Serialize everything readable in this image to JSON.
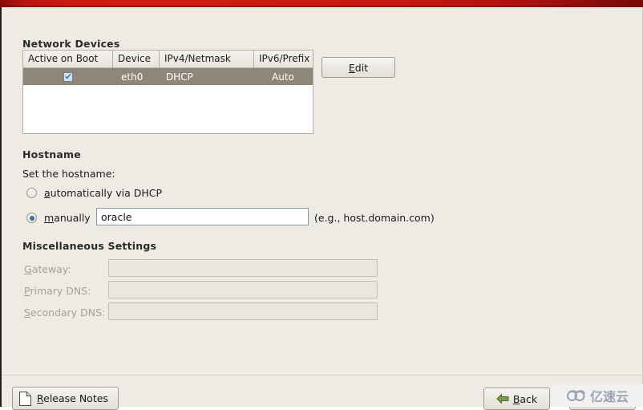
{
  "window": {
    "accent_band_color": "#cc1a12",
    "background_color": "#eeebe5"
  },
  "network_devices": {
    "heading": "Network Devices",
    "columns": [
      "Active on Boot",
      "Device",
      "IPv4/Netmask",
      "IPv6/Prefix"
    ],
    "rows": [
      {
        "active_on_boot": true,
        "device": "eth0",
        "ipv4_netmask": "DHCP",
        "ipv6_prefix": "Auto",
        "selected": true
      }
    ],
    "edit_button": {
      "label": "Edit",
      "mnemonic_prefix": "E",
      "mnemonic_rest": "dit"
    }
  },
  "hostname": {
    "heading": "Hostname",
    "prompt": "Set the hostname:",
    "options": [
      {
        "id": "automatic",
        "mnemonic_prefix": "a",
        "mnemonic_rest": "utomatically via DHCP",
        "selected": false
      },
      {
        "id": "manual",
        "mnemonic_prefix": "m",
        "mnemonic_rest": "anually",
        "selected": true
      }
    ],
    "input_value": "oracle",
    "input_placeholder": "",
    "example_hint": "(e.g., host.domain.com)"
  },
  "miscellaneous": {
    "heading": "Miscellaneous Settings",
    "fields": [
      {
        "mnemonic_prefix": "G",
        "mnemonic_rest": "ateway:",
        "value": "",
        "enabled": false
      },
      {
        "mnemonic_prefix": "P",
        "mnemonic_rest": "rimary DNS:",
        "value": "",
        "enabled": false
      },
      {
        "mnemonic_prefix": "S",
        "mnemonic_rest": "econdary DNS:",
        "value": "",
        "enabled": false
      }
    ]
  },
  "footer": {
    "release_notes": {
      "mnemonic_prefix": "R",
      "mnemonic_rest": "elease Notes",
      "icon": "document-icon"
    },
    "back": {
      "mnemonic_prefix": "B",
      "mnemonic_rest": "ack",
      "icon": "arrow-left-icon"
    },
    "next": {
      "mnemonic_prefix": "",
      "mnemonic_rest": "",
      "icon": "arrow-right-icon"
    }
  },
  "watermark": {
    "text": "亿速云",
    "logo": "cloud-logo",
    "color": "#9aa3b5"
  }
}
